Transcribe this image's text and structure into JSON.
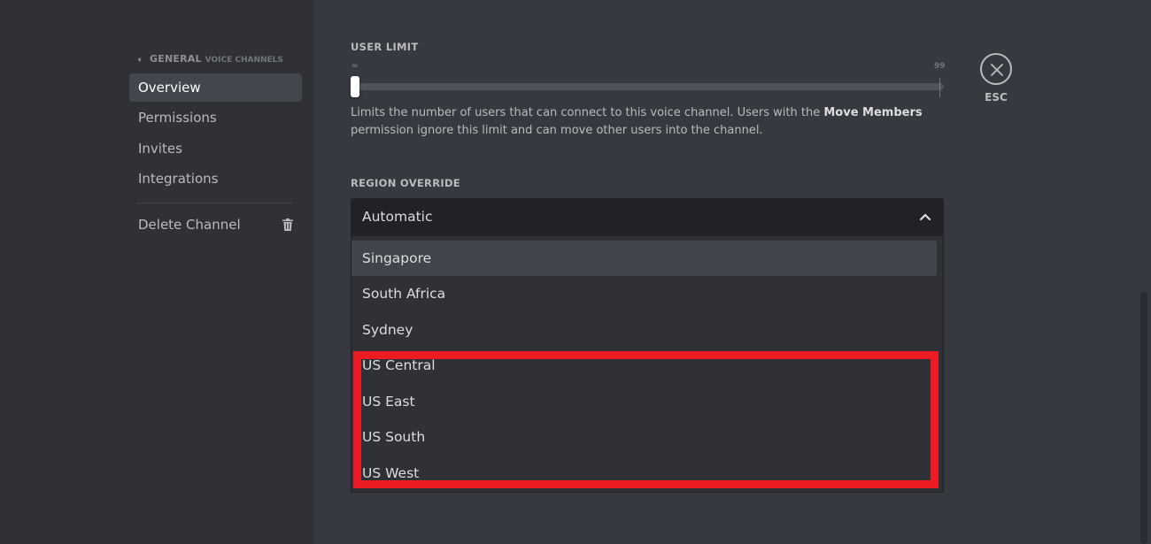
{
  "sidebar": {
    "channel_name": "GENERAL",
    "channel_category": "VOICE CHANNELS",
    "items": [
      {
        "label": "Overview"
      },
      {
        "label": "Permissions"
      },
      {
        "label": "Invites"
      },
      {
        "label": "Integrations"
      }
    ],
    "delete_label": "Delete Channel"
  },
  "user_limit": {
    "label": "USER LIMIT",
    "min_marker": "∞",
    "max_marker": "99",
    "value_fraction": 0,
    "help_before": "Limits the number of users that can connect to this voice channel. Users with the ",
    "help_bold": "Move Members",
    "help_after": " permission ignore this limit and can move other users into the channel."
  },
  "region_override": {
    "label": "REGION OVERRIDE",
    "selected": "Automatic",
    "options": [
      {
        "label": "Singapore"
      },
      {
        "label": "South Africa"
      },
      {
        "label": "Sydney"
      },
      {
        "label": "US Central"
      },
      {
        "label": "US East"
      },
      {
        "label": "US South"
      },
      {
        "label": "US West"
      }
    ]
  },
  "close": {
    "label": "ESC"
  },
  "colors": {
    "highlight": "#ed1c24",
    "sidebar_bg": "#2f3136",
    "content_bg": "#36393f"
  }
}
